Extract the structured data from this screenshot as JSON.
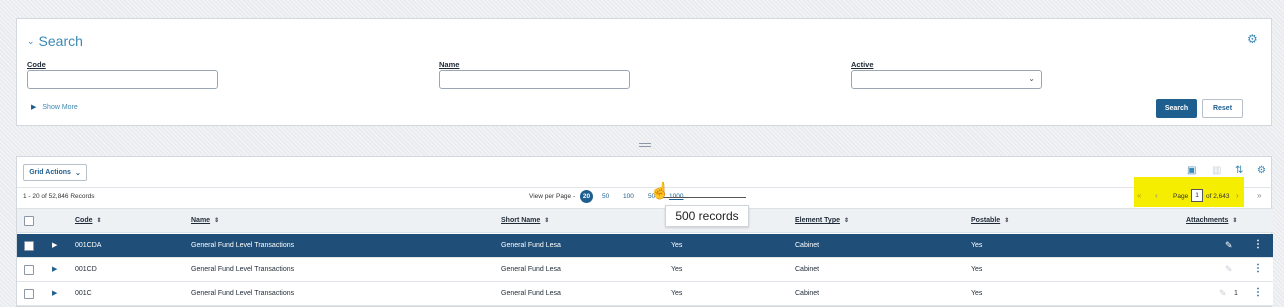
{
  "search": {
    "title": "Search",
    "fields": {
      "code": {
        "label": "Code",
        "value": ""
      },
      "name": {
        "label": "Name",
        "value": ""
      },
      "active": {
        "label": "Active",
        "value": ""
      }
    },
    "show_more": "Show More",
    "search_button": "Search",
    "reset_button": "Reset"
  },
  "grid": {
    "actions_label": "Grid Actions",
    "records_text": "1 - 20 of 52,846 Records",
    "view_per_page_label": "View per Page -",
    "view_per_page_options": [
      "20",
      "50",
      "100",
      "500",
      "1000"
    ],
    "view_per_page_selected": "20",
    "pagination": {
      "first": "«",
      "prev": "‹",
      "page_label": "Page",
      "page_value": "1",
      "of_text": "of 2,643",
      "next": "›",
      "last": "»"
    },
    "tooltip": "500 records",
    "columns": [
      "Code",
      "Name",
      "Short Name",
      "Active",
      "Element Type",
      "Postable",
      "Attachments"
    ],
    "rows": [
      {
        "code": "001CDA",
        "name": "General Fund Level Transactions",
        "short_name": "General Fund Lesa",
        "active": "Yes",
        "element_type": "Cabinet",
        "postable": "Yes",
        "attachments": ""
      },
      {
        "code": "001CD",
        "name": "General Fund Level Transactions",
        "short_name": "General Fund Lesa",
        "active": "Yes",
        "element_type": "Cabinet",
        "postable": "Yes",
        "attachments": ""
      },
      {
        "code": "001C",
        "name": "General Fund Level Transactions",
        "short_name": "General Fund Lesa",
        "active": "Yes",
        "element_type": "Cabinet",
        "postable": "Yes",
        "attachments": "1"
      }
    ]
  },
  "colors": {
    "accent": "#1f5f8f",
    "link": "#3c88b5",
    "selected_row": "#1f4f78",
    "highlight": "#f6ee00"
  }
}
